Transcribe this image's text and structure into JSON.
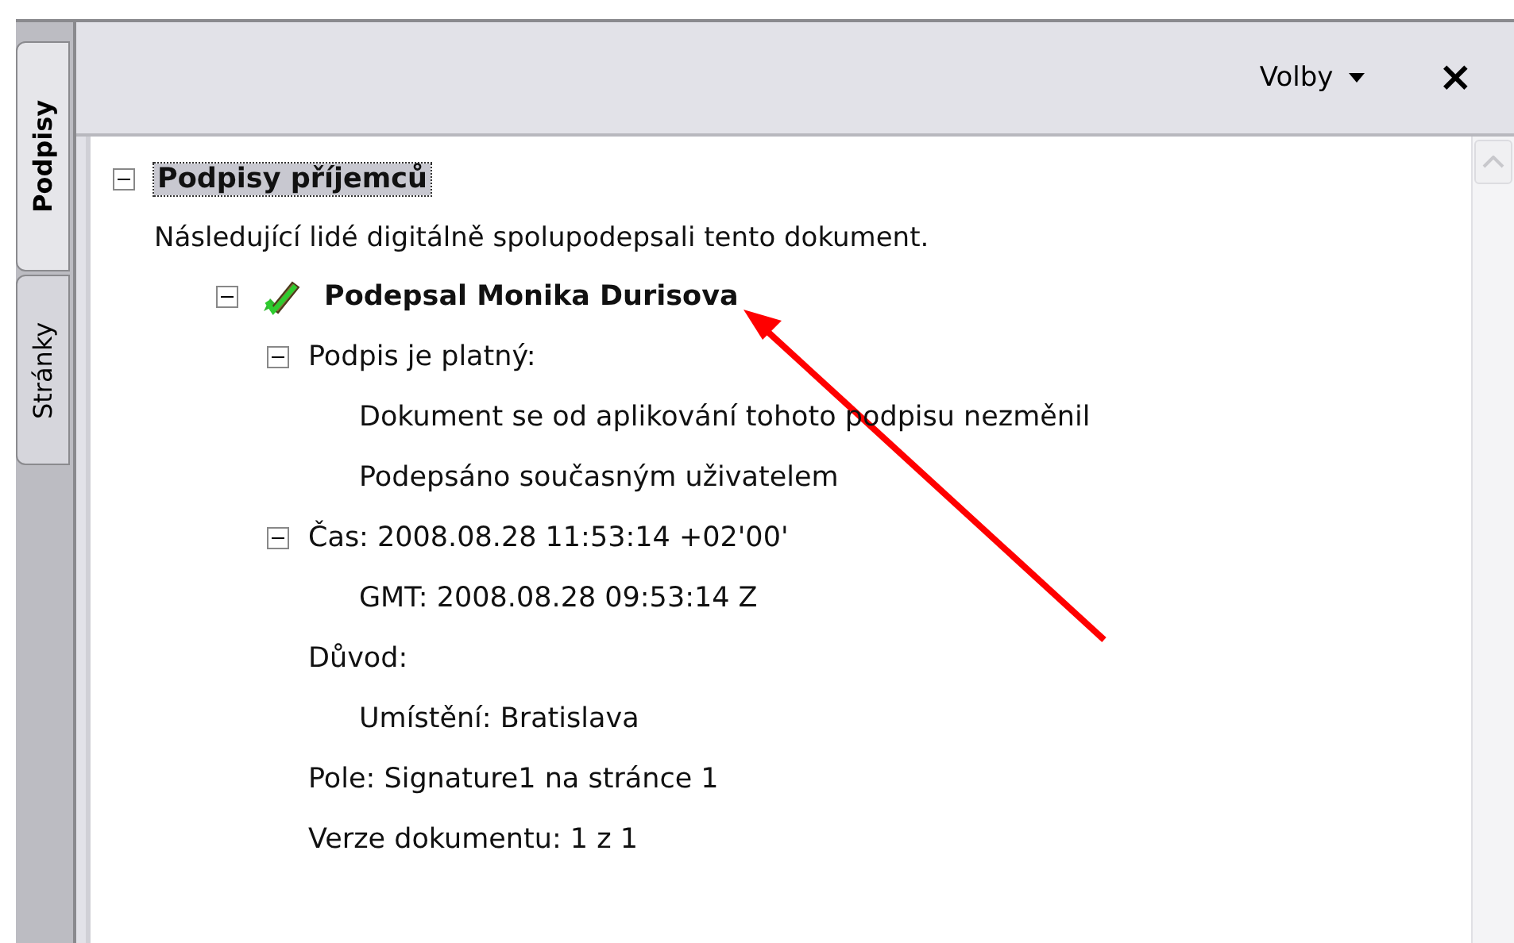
{
  "side_tabs": [
    {
      "label": "Podpisy",
      "selected": true
    },
    {
      "label": "Stránky",
      "selected": false
    }
  ],
  "header": {
    "options_label": "Volby",
    "close_label": "×"
  },
  "tree": {
    "label": "Podpisy příjemců",
    "expanded": true,
    "selected": true,
    "description": "Následující lidé digitálně spolupodepsali tento dokument.",
    "children": [
      {
        "label": "Podepsal Monika Durisova",
        "kind": "signer",
        "expanded": true,
        "children": [
          {
            "label": "Podpis je platný:",
            "expanded": true,
            "children": [
              {
                "label": "Dokument se od aplikování tohoto podpisu nezměnil"
              },
              {
                "label": "Podepsáno současným uživatelem"
              }
            ]
          },
          {
            "label": "Čas: 2008.08.28 11:53:14 +02'00'",
            "expanded": true,
            "children": [
              {
                "label": "GMT: 2008.08.28 09:53:14 Z"
              }
            ]
          },
          {
            "label": "Důvod:",
            "children": [
              {
                "label": "Umístění: Bratislava"
              }
            ]
          },
          {
            "label": "Pole: Signature1 na stránce 1"
          },
          {
            "label": "Verze dokumentu: 1 z 1"
          }
        ]
      }
    ]
  }
}
